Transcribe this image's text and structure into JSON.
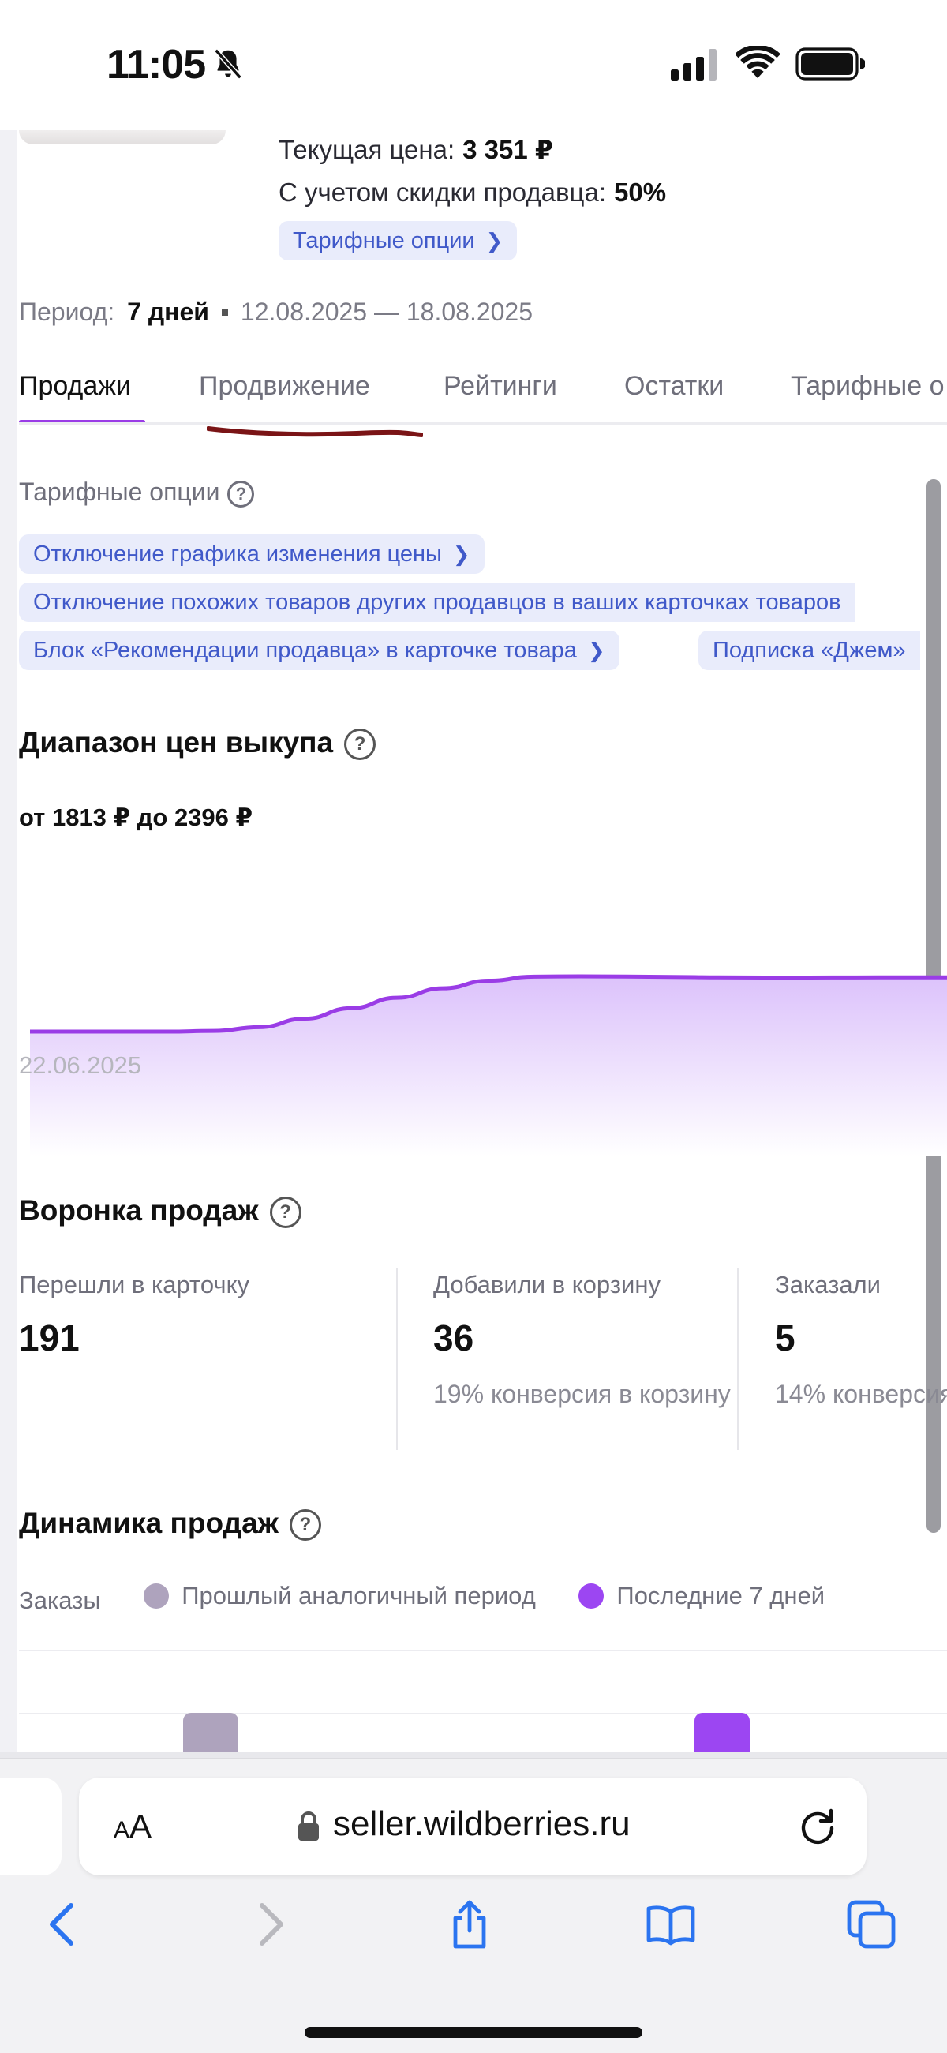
{
  "status_bar": {
    "time": "11:05"
  },
  "product": {
    "current_price_label": "Текущая цена:",
    "current_price_value": "3 351 ₽",
    "discount_label": "С учетом скидки продавца:",
    "discount_value": "50%",
    "tariff_options_link": "Тарифные опции"
  },
  "period": {
    "label": "Период:",
    "value": "7 дней",
    "range": "12.08.2025 — 18.08.2025"
  },
  "tabs": [
    {
      "label": "Продажи",
      "active": true
    },
    {
      "label": "Продвижение",
      "active": false
    },
    {
      "label": "Рейтинги",
      "active": false
    },
    {
      "label": "Остатки",
      "active": false
    },
    {
      "label": "Тарифные о",
      "active": false
    }
  ],
  "tariff_options": {
    "title": "Тарифные опции",
    "chips": [
      "Отключение графика изменения цены",
      "Отключение похожих товаров других продавцов в ваших карточках товаров",
      "Блок «Рекомендации продавца» в карточке товара",
      "Подписка «Джем»"
    ]
  },
  "price_range": {
    "title": "Диапазон цен выкупа",
    "range_text": "от 1813 ₽ до 2396 ₽",
    "start_date": "22.06.2025"
  },
  "chart_data": {
    "type": "area",
    "title": "Диапазон цен выкупа",
    "x_start_label": "22.06.2025",
    "y_min": 1813,
    "y_max": 2396,
    "values": [
      1813,
      1813,
      1813,
      1813,
      1820,
      1860,
      1950,
      2060,
      2170,
      2270,
      2350,
      2393,
      2396,
      2394,
      2390,
      2386,
      2384,
      2384,
      2385,
      2386,
      2386
    ]
  },
  "funnel": {
    "title": "Воронка продаж",
    "steps": [
      {
        "label": "Перешли в карточку",
        "value": "191",
        "conversion": ""
      },
      {
        "label": "Добавили в корзину",
        "value": "36",
        "conversion": "19% конверсия в корзину"
      },
      {
        "label": "Заказали",
        "value": "5",
        "conversion": "14% конверсия"
      }
    ]
  },
  "sales_dynamics": {
    "title": "Динамика продаж",
    "metric_label": "Заказы",
    "legend_prev": "Прошлый аналогичный период",
    "legend_last": "Последние 7 дней",
    "color_prev": "#aea3bd",
    "color_last": "#9c46f2"
  },
  "browser": {
    "text_size_label_small": "A",
    "text_size_label_large": "A",
    "url": "seller.wildberries.ru"
  },
  "colors": {
    "accent": "#9a3ce6",
    "chip_bg": "#e9ecfb",
    "chip_text": "#4059c9",
    "annotation": "#7a1416"
  }
}
